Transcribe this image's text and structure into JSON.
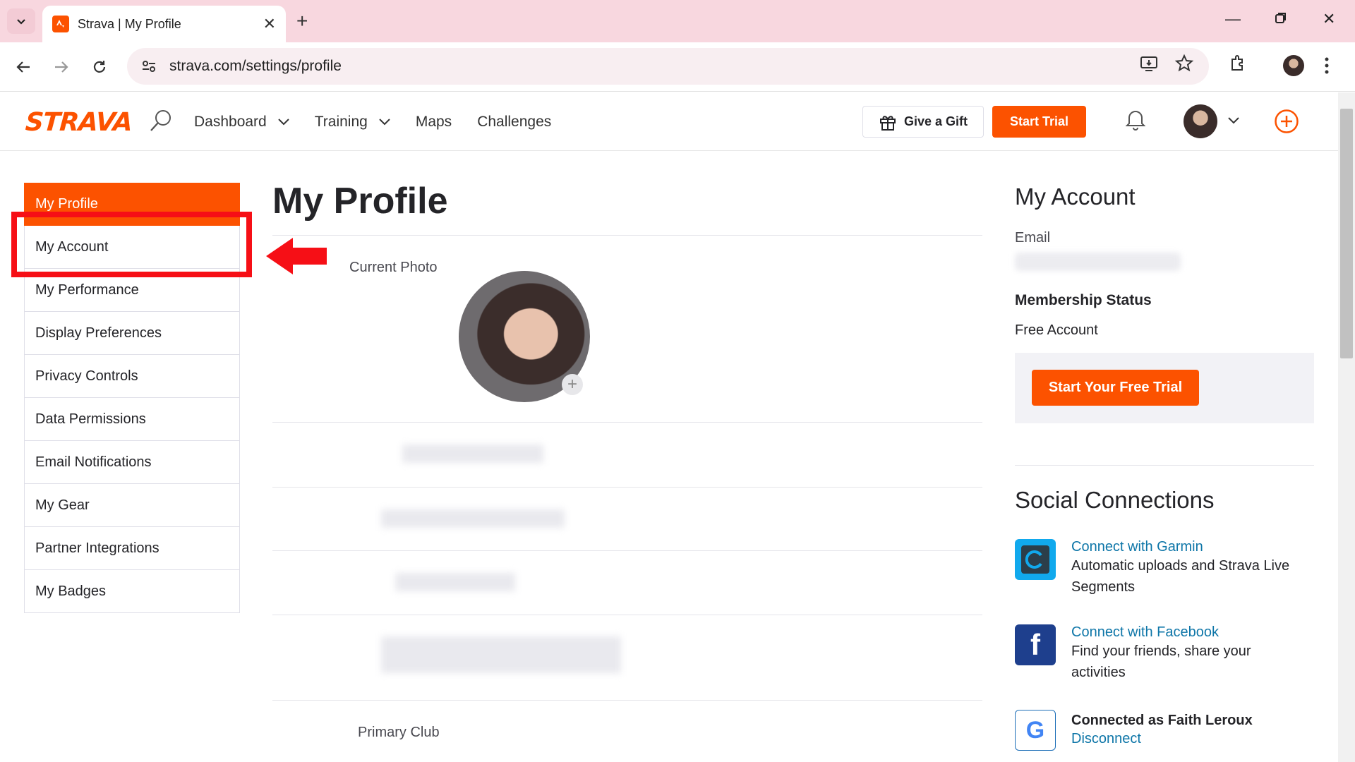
{
  "browser": {
    "tab_title": "Strava | My Profile",
    "url": "strava.com/settings/profile"
  },
  "header": {
    "logo": "STRAVA",
    "nav": [
      {
        "label": "Dashboard"
      },
      {
        "label": "Training"
      },
      {
        "label": "Maps"
      },
      {
        "label": "Challenges"
      }
    ],
    "gift_label": "Give a Gift",
    "trial_label": "Start Trial"
  },
  "sidebar": {
    "items": [
      {
        "label": "My Profile"
      },
      {
        "label": "My Account"
      },
      {
        "label": "My Performance"
      },
      {
        "label": "Display Preferences"
      },
      {
        "label": "Privacy Controls"
      },
      {
        "label": "Data Permissions"
      },
      {
        "label": "Email Notifications"
      },
      {
        "label": "My Gear"
      },
      {
        "label": "Partner Integrations"
      },
      {
        "label": "My Badges"
      }
    ]
  },
  "main": {
    "title": "My Profile",
    "current_photo_label": "Current Photo",
    "primary_club_label": "Primary Club"
  },
  "account": {
    "title": "My Account",
    "email_label": "Email",
    "membership_label": "Membership Status",
    "membership_value": "Free Account",
    "free_trial_button": "Start Your Free Trial"
  },
  "social": {
    "title": "Social Connections",
    "garmin_link": "Connect with Garmin",
    "garmin_desc": "Automatic uploads and Strava Live Segments",
    "facebook_link": "Connect with Facebook",
    "facebook_desc": "Find your friends, share your activities",
    "google_status": "Connected as Faith Leroux",
    "google_disconnect": "Disconnect"
  },
  "colors": {
    "brand": "#fc5200",
    "highlight": "#f60f16",
    "link": "#0e76a8"
  }
}
